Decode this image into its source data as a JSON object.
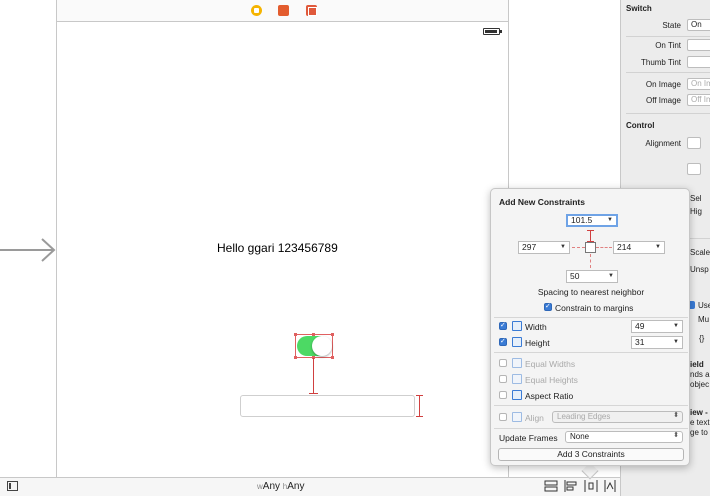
{
  "canvas": {
    "label_text": "Hello ggari 123456789",
    "size_class": {
      "w_prefix": "w",
      "w_value": "Any",
      "h_prefix": "h",
      "h_value": "Any"
    }
  },
  "inspector": {
    "switch_section": "Switch",
    "state_label": "State",
    "state_value": "On",
    "on_tint_label": "On Tint",
    "thumb_tint_label": "Thumb Tint",
    "on_image_label": "On Image",
    "on_image_placeholder": "On Im",
    "off_image_label": "Off Image",
    "off_image_placeholder": "Off Im",
    "control_section": "Control",
    "alignment_label": "Alignment",
    "fragments": [
      "Sel",
      "Hig",
      "Scale",
      "Unsp",
      "Use",
      "Mu",
      "{}",
      "ield",
      "nds a",
      "objec",
      "iew -",
      "e text",
      "ge to"
    ]
  },
  "popover": {
    "title": "Add New Constraints",
    "top_value": "101.5",
    "left_value": "297",
    "right_value": "214",
    "bottom_value": "50",
    "spacing_caption": "Spacing to nearest neighbor",
    "margins_label": "Constrain to margins",
    "width_label": "Width",
    "width_value": "49",
    "height_label": "Height",
    "height_value": "31",
    "equal_widths_label": "Equal Widths",
    "equal_heights_label": "Equal Heights",
    "aspect_ratio_label": "Aspect Ratio",
    "align_label": "Align",
    "align_value": "Leading Edges",
    "update_frames_label": "Update Frames",
    "update_frames_value": "None",
    "add_button_label": "Add 3 Constraints"
  },
  "colors": {
    "switch_on": "#4cd964",
    "constraint": "#d04040",
    "selection_blue": "#3a7bd5"
  }
}
